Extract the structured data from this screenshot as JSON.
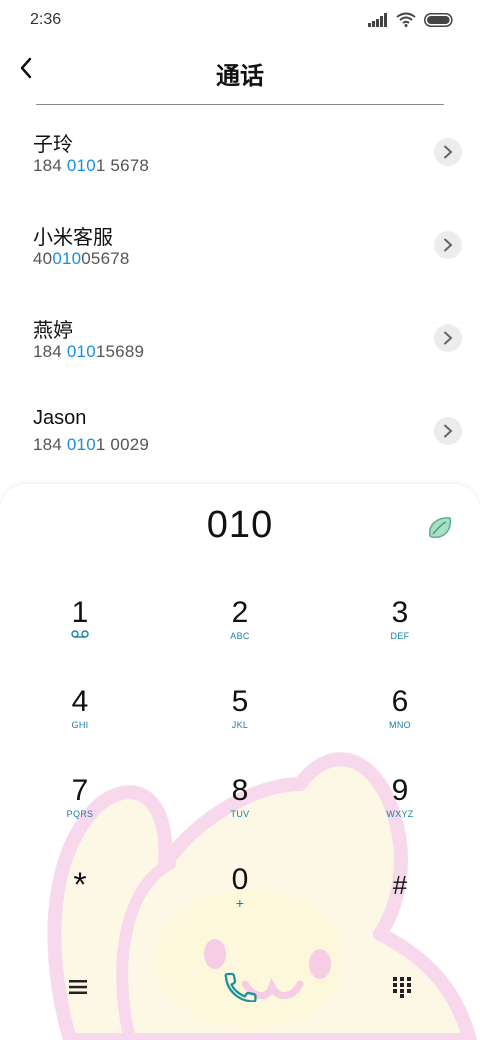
{
  "status_bar": {
    "time": "2:36"
  },
  "header": {
    "title": "通话"
  },
  "contacts": [
    {
      "name": "子玲",
      "number_pre": "184 ",
      "number_hl": "010",
      "number_post": "1 5678"
    },
    {
      "name": "小米客服",
      "number_pre": "40",
      "number_hl": "010",
      "number_post": "05678"
    },
    {
      "name": "燕婷",
      "number_pre": "184 ",
      "number_hl": "010",
      "number_post": "15689"
    },
    {
      "name": "Jason",
      "number_pre": "184 ",
      "number_hl": "010",
      "number_post": "1 0029"
    }
  ],
  "dialpad": {
    "display": "010",
    "keys": [
      {
        "digit": "1",
        "sub": ""
      },
      {
        "digit": "2",
        "sub": "ABC"
      },
      {
        "digit": "3",
        "sub": "DEF"
      },
      {
        "digit": "4",
        "sub": "GHI"
      },
      {
        "digit": "5",
        "sub": "JKL"
      },
      {
        "digit": "6",
        "sub": "MNO"
      },
      {
        "digit": "7",
        "sub": "PQRS"
      },
      {
        "digit": "8",
        "sub": "TUV"
      },
      {
        "digit": "9",
        "sub": "WXYZ"
      },
      {
        "digit": "*",
        "sub": ""
      },
      {
        "digit": "0",
        "sub": "+"
      },
      {
        "digit": "#",
        "sub": ""
      }
    ]
  },
  "colors": {
    "highlight": "#1a8fde",
    "call": "#1a8f9e",
    "subtext": "#1a7fa6"
  },
  "icons": [
    "back-icon",
    "chevron-right-icon",
    "leaf-icon",
    "voicemail-icon",
    "menu-icon",
    "call-icon",
    "dialpad-icon"
  ]
}
